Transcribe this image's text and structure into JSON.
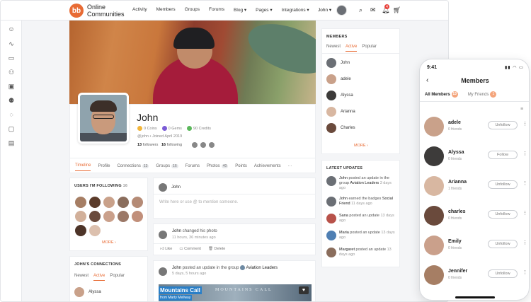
{
  "topbar": {
    "brand_line1": "Online",
    "brand_line2": "Communities",
    "logo_text": "bb",
    "nav": [
      "Activity",
      "Members",
      "Groups",
      "Forums",
      "Blog ▾",
      "Pages ▾",
      "Integrations ▾"
    ],
    "user_name": "John ▾",
    "bell_count": "4",
    "icons": [
      "search-icon",
      "inbox-icon",
      "bell-icon",
      "cart-icon"
    ]
  },
  "profile": {
    "name": "John",
    "coins": "0 Coins",
    "gems": "0 Gems",
    "credits": "90 Credits",
    "handle": "@john • Joined April 2019",
    "followers_count": "13",
    "followers_label": "followers",
    "following_count": "16",
    "following_label": "following"
  },
  "tabs": [
    {
      "label": "Timeline",
      "count": ""
    },
    {
      "label": "Profile",
      "count": ""
    },
    {
      "label": "Connections",
      "count": "13"
    },
    {
      "label": "Groups",
      "count": "16"
    },
    {
      "label": "Forums",
      "count": ""
    },
    {
      "label": "Photos",
      "count": "40"
    },
    {
      "label": "Points",
      "count": ""
    },
    {
      "label": "Achievements",
      "count": ""
    },
    {
      "label": "···",
      "count": ""
    }
  ],
  "following_widget": {
    "title": "USERS I'M FOLLOWING",
    "count": "16",
    "more": "MORE ›"
  },
  "connections_widget": {
    "title": "JOHN'S CONNECTIONS",
    "tabs": [
      "Newest",
      "Active",
      "Popular"
    ],
    "first_member": "Alyssa"
  },
  "post_box": {
    "user": "John",
    "placeholder": "Write here or use @ to mention someone."
  },
  "activity1": {
    "user": "John",
    "text": "changed his photo",
    "time": "11 hours, 36 minutes ago",
    "like": "Like",
    "comment": "Comment",
    "delete": "Delete"
  },
  "activity2": {
    "user": "John",
    "text": "posted an update in the group",
    "group": "Aviation Leaders",
    "time": "5 days, 5 hours ago",
    "media_title": "Mountains Call",
    "media_sub": "from Marty Mellway",
    "media_bg": "MOUNTAINS CALL"
  },
  "members_widget": {
    "title": "MEMBERS",
    "tabs": [
      "Newest",
      "Active",
      "Popular"
    ],
    "members": [
      "John",
      "adele",
      "Alyssa",
      "Arianna",
      "Charles"
    ],
    "more": "MORE ›"
  },
  "updates_widget": {
    "title": "LATEST UPDATES",
    "items": [
      {
        "user": "John",
        "line1": "posted an update in the",
        "line2": "group",
        "group": "Aviation Leaders",
        "time": "3 days ago"
      },
      {
        "user": "John",
        "line1": "earned the badges",
        "line2": "Social Friend",
        "time": "11 days ago"
      },
      {
        "user": "Sana",
        "line1": "posted an update",
        "time": "13 days ago"
      },
      {
        "user": "Maria",
        "line1": "posted an update",
        "time": "13 days ago"
      },
      {
        "user": "Margaret",
        "line1": "posted an update",
        "time": "13 days ago"
      }
    ]
  },
  "phone": {
    "time": "9:41",
    "title": "Members",
    "tab_all": "All Members",
    "tab_all_count": "13",
    "tab_friends": "My Friends",
    "tab_friends_count": "1",
    "members": [
      {
        "name": "adele",
        "sub": "0 friends",
        "action": "Unfollow"
      },
      {
        "name": "Alyssa",
        "sub": "0 friends",
        "action": "Follow"
      },
      {
        "name": "Arianna",
        "sub": "1 friends",
        "action": "Unfollow"
      },
      {
        "name": "charles",
        "sub": "0 friends",
        "action": "Unfollow"
      },
      {
        "name": "Emily",
        "sub": "0 friends",
        "action": "Unfollow"
      },
      {
        "name": "Jennifer",
        "sub": "0 friends",
        "action": "Unfollow"
      }
    ]
  },
  "colors": {
    "accent": "#e86b34",
    "link_blue": "#1e6fe0"
  }
}
